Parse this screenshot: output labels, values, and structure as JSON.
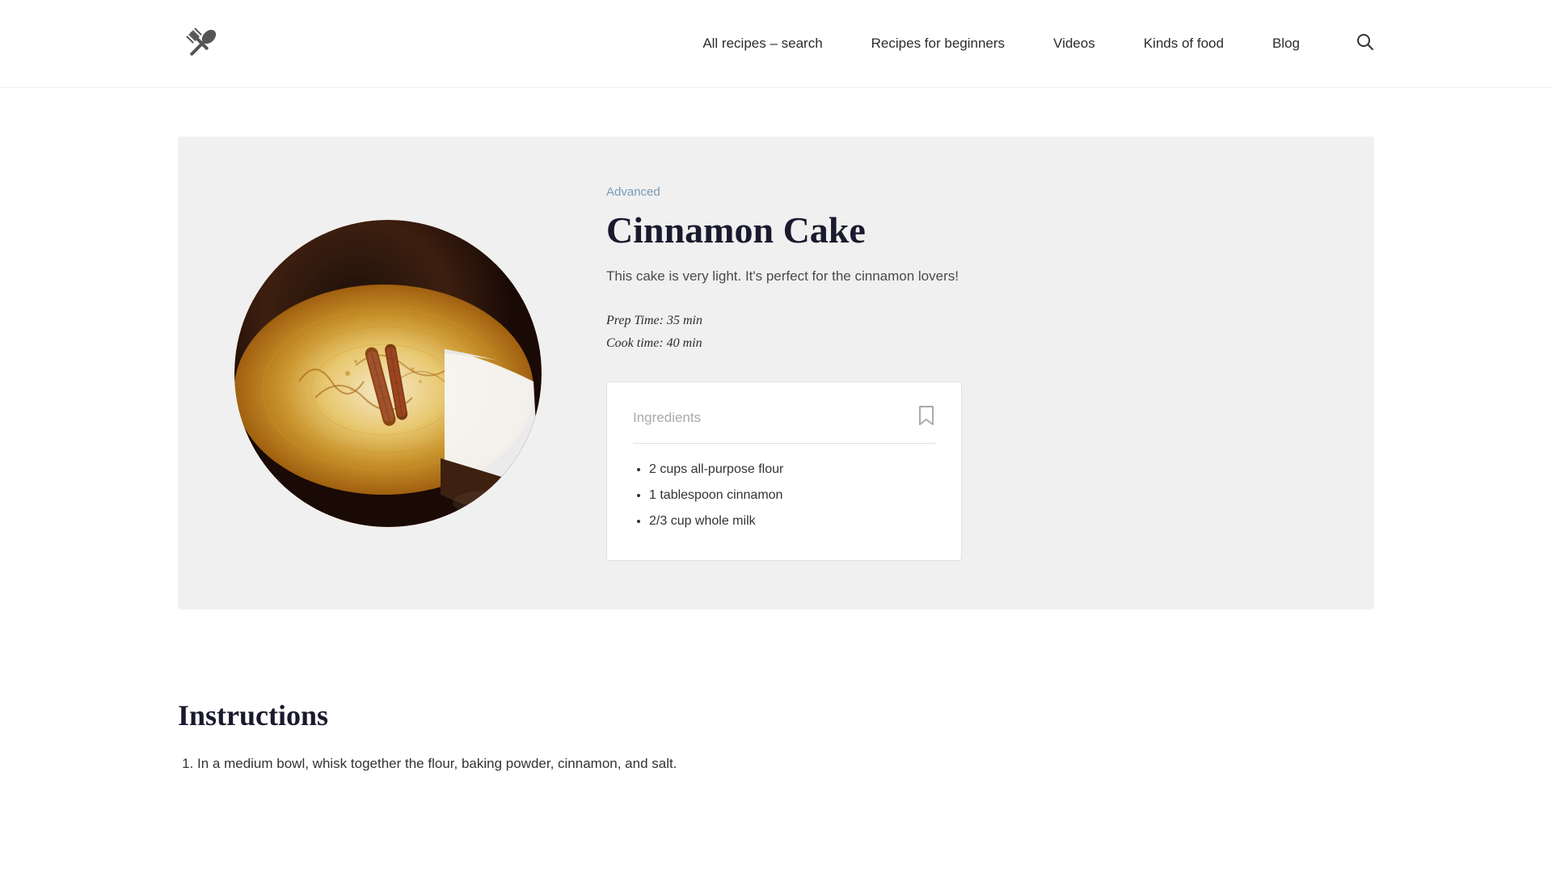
{
  "header": {
    "logo_alt": "Recipe Site Logo",
    "nav": {
      "links": [
        {
          "label": "All recipes – search",
          "id": "all-recipes"
        },
        {
          "label": "Recipes for beginners",
          "id": "beginners"
        },
        {
          "label": "Videos",
          "id": "videos"
        },
        {
          "label": "Kinds of food",
          "id": "kinds"
        },
        {
          "label": "Blog",
          "id": "blog"
        }
      ],
      "search_icon": "🔍"
    }
  },
  "recipe": {
    "level": "Advanced",
    "title": "Cinnamon Cake",
    "description": "This cake is very light. It's perfect for the cinnamon lovers!",
    "prep_time": "Prep Time: 35 min",
    "cook_time": "Cook time: 40 min",
    "ingredients": {
      "title": "Ingredients",
      "items": [
        "2 cups all-purpose flour",
        "1 tablespoon cinnamon",
        "2/3 cup whole milk"
      ]
    }
  },
  "instructions": {
    "title": "Instructions",
    "steps": [
      "In a medium bowl, whisk together the flour, baking powder, cinnamon, and salt."
    ]
  }
}
